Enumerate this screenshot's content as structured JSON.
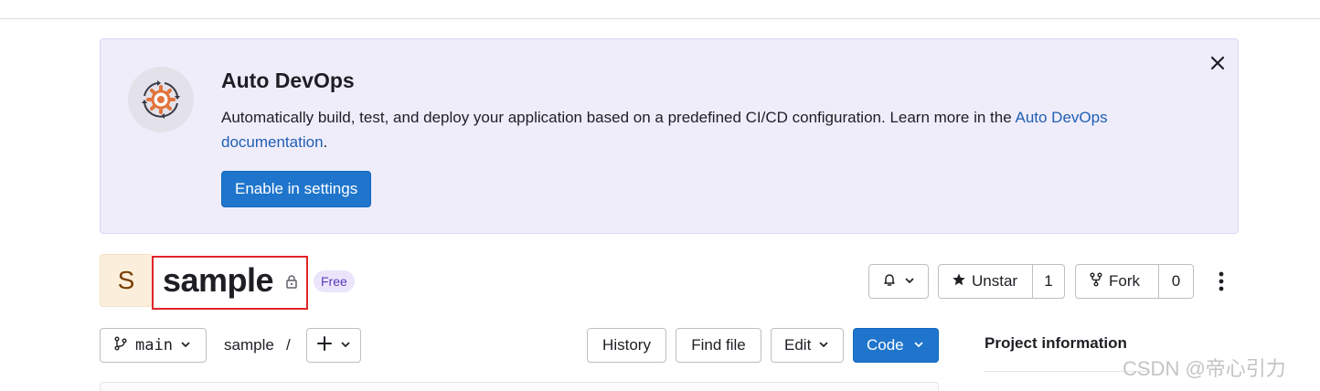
{
  "banner": {
    "title": "Auto DevOps",
    "body_text": "Automatically build, test, and deploy your application based on a predefined CI/CD configuration. Learn more in the ",
    "link_text": "Auto DevOps documentation",
    "body_end": ".",
    "button_label": "Enable in settings",
    "icons": {
      "illustration": "auto-devops-gear-icon",
      "close": "close-icon"
    }
  },
  "project": {
    "avatar_letter": "S",
    "name": "sample",
    "visibility_icon": "lock-icon",
    "badge": "Free"
  },
  "actions": {
    "notification_icon": "bell-icon",
    "star_label": "Unstar",
    "star_count": "1",
    "fork_label": "Fork",
    "fork_count": "0",
    "more_icon": "vertical-ellipsis-icon"
  },
  "repo_toolbar": {
    "branch": "main",
    "path_root": "sample",
    "path_sep": "/",
    "add_icon": "plus-icon",
    "history_label": "History",
    "find_file_label": "Find file",
    "edit_label": "Edit",
    "code_label": "Code"
  },
  "sidebar": {
    "title": "Project information"
  },
  "watermark": "CSDN @帝心引力",
  "colors": {
    "banner_bg": "#f0edfb",
    "primary": "#1f75cb",
    "link": "#1f5fb3",
    "badge_bg": "#ebe5fb",
    "badge_text": "#5b3bb8",
    "highlight_box": "#e0252a"
  }
}
